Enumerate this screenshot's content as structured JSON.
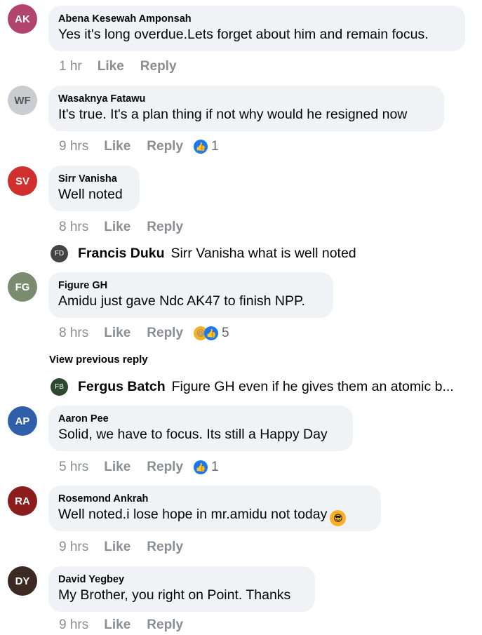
{
  "comments": [
    {
      "author": "Abena Kesewah Amponsah",
      "text": "Yes it's long overdue.Lets forget about him and remain focus.",
      "time": "1 hr",
      "like": "Like",
      "reply": "Reply",
      "avatar_color": "#b2456e",
      "avatar_initials": "AK"
    },
    {
      "author": "Wasaknya Fatawu",
      "text": "It's true. It's a plan thing if not why would he  resigned now",
      "time": "9 hrs",
      "like": "Like",
      "reply": "Reply",
      "reactions": "1",
      "avatar_color": "#9aa0a8",
      "avatar_initials": "WF"
    },
    {
      "author": "Sirr Vanisha",
      "text": "Well noted",
      "time": "8 hrs",
      "like": "Like",
      "reply": "Reply",
      "avatar_color": "#d12e2e",
      "avatar_initials": "SV"
    },
    {
      "author": "Figure GH",
      "text": "Amidu just gave Ndc AK47 to finish NPP.",
      "time": "8 hrs",
      "like": "Like",
      "reply": "Reply",
      "reactions": "5",
      "avatar_color": "#7a8b6f",
      "avatar_initials": "FG"
    },
    {
      "author": "Aaron Pee",
      "text": "Solid, we have to focus. Its still a Happy Day",
      "time": "5 hrs",
      "like": "Like",
      "reply": "Reply",
      "reactions": "1",
      "avatar_color": "#2f5fa8",
      "avatar_initials": "AP"
    },
    {
      "author": "Rosemond Ankrah",
      "text": "Well noted.i lose hope in mr.amidu not today",
      "time": "9 hrs",
      "like": "Like",
      "reply": "Reply",
      "avatar_color": "#8b1d1d",
      "avatar_initials": "RA"
    },
    {
      "author": "David Yegbey",
      "text": "My Brother, you right on Point. Thanks",
      "time": "9 hrs",
      "like": "Like",
      "reply": "Reply",
      "avatar_color": "#3a2a22",
      "avatar_initials": "DY"
    }
  ],
  "replies": {
    "francis": {
      "author": "Francis Duku",
      "text": "Sirr Vanisha what is well noted",
      "avatar_color": "#444444"
    },
    "fergus": {
      "author": "Fergus Batch",
      "text": "Figure GH even if he gives them an atomic b...",
      "avatar_color": "#2e4a2e"
    }
  },
  "view_previous": "View previous reply",
  "colors": {
    "bubble": "#f0f2f5",
    "meta": "#8a8d91",
    "like_blue": "#1877f2",
    "haha_yellow": "#f7b125"
  },
  "icons": {
    "like_reaction": "thumbs-up-icon",
    "haha_reaction": "laughing-face-icon",
    "cool_emoji": "sunglasses-emoji-icon"
  }
}
